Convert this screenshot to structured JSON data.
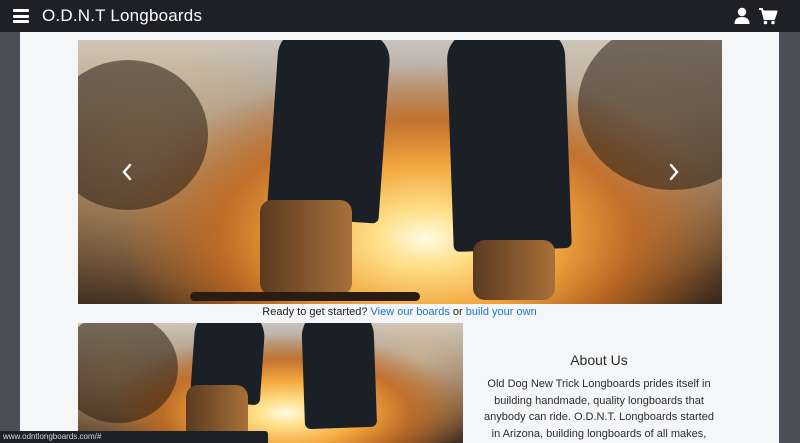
{
  "header": {
    "menu_icon": "hamburger-menu-icon",
    "brand": "O.D.N.T Longboards",
    "user_icon": "user-icon",
    "cart_icon": "shopping-cart-icon"
  },
  "carousel": {
    "prev_icon": "chevron-left-icon",
    "next_icon": "chevron-right-icon"
  },
  "cta": {
    "prefix": "Ready to get started?",
    "link1": "View our boards",
    "middle": "or",
    "link2": "build your own"
  },
  "about": {
    "heading": "About Us",
    "body": "Old Dog New Trick Longboards prides itself in building handmade, quality longboards that anybody can ride. O.D.N.T. Longboards started in Arizona, building longboards of all makes, and"
  },
  "status_bar": {
    "url": "www.odntlongboards.com/#"
  },
  "colors": {
    "navbar_bg": "#1e2026",
    "page_bg": "#f5f6f8",
    "link": "#1a73d9",
    "outer_bg": "#4a4f57"
  }
}
